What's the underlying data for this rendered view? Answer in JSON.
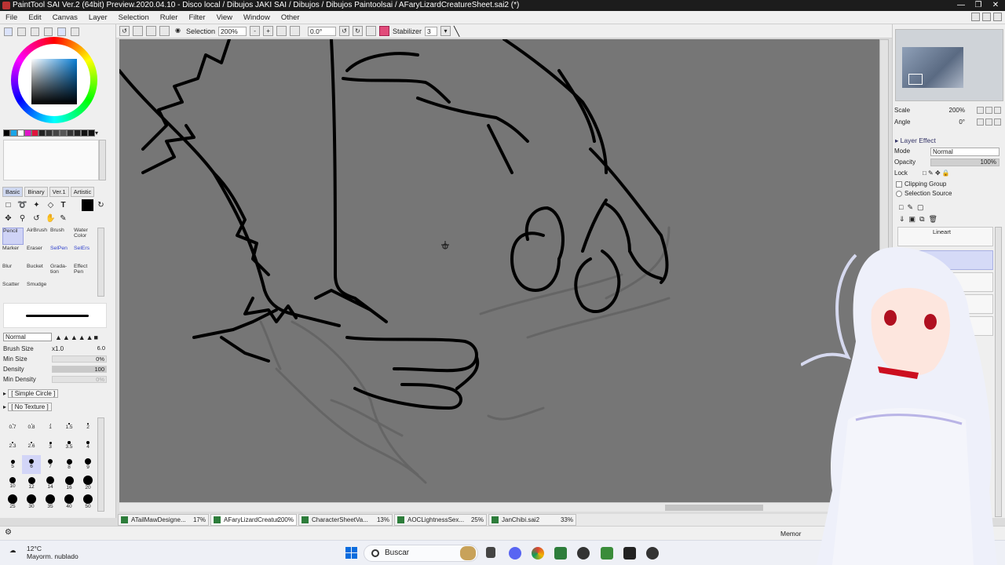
{
  "window": {
    "title": "PaintTool SAI Ver.2 (64bit) Preview.2020.04.10 - Disco local / Dibujos JAKI SAI / Dibujos / Dibujos Paintoolsai / AFaryLizardCreatureSheet.sai2 (*)"
  },
  "menu": [
    "File",
    "Edit",
    "Canvas",
    "Layer",
    "Selection",
    "Ruler",
    "Filter",
    "View",
    "Window",
    "Other"
  ],
  "toolbar": {
    "selection_label": "Selection",
    "zoom": "200%",
    "angle": "0.0°",
    "stabilizer_label": "Stabilizer",
    "stabilizer_value": "3"
  },
  "tool_tabs": [
    "Basic",
    "Binary",
    "Ver.1",
    "Artistic"
  ],
  "brushes": [
    {
      "name": "Pencil",
      "active": true
    },
    {
      "name": "AirBrush",
      "active": false
    },
    {
      "name": "Brush",
      "active": false
    },
    {
      "name": "Water Color",
      "active": false
    },
    {
      "name": "Marker",
      "active": false
    },
    {
      "name": "Eraser",
      "active": false
    },
    {
      "name": "SelPen",
      "active": false
    },
    {
      "name": "SelErs",
      "active": false
    },
    {
      "name": "Blur",
      "active": false
    },
    {
      "name": "Bucket",
      "active": false
    },
    {
      "name": "Grada- tion",
      "active": false
    },
    {
      "name": "Effect Pen",
      "active": false
    },
    {
      "name": "Scatter",
      "active": false
    },
    {
      "name": "Smudge",
      "active": false
    }
  ],
  "brush_settings": {
    "mode": "Normal",
    "brush_size_label": "Brush Size",
    "brush_size_mult": "x1.0",
    "brush_size": "6.0",
    "min_size_label": "Min Size",
    "min_size": "0%",
    "density_label": "Density",
    "density": "100",
    "min_density_label": "Min Density",
    "min_density": "0%",
    "shape": "[ Simple Circle ]",
    "texture": "[ No Texture ]"
  },
  "brush_sizes": [
    "0.7",
    "0.8",
    "1",
    "1.5",
    "2",
    "2.3",
    "2.6",
    "3",
    "3.5",
    "4",
    "5",
    "6",
    "7",
    "8",
    "9",
    "10",
    "12",
    "14",
    "16",
    "20",
    "25",
    "30",
    "35",
    "40",
    "50"
  ],
  "navigator": {
    "scale_label": "Scale",
    "scale": "200%",
    "angle_label": "Angle",
    "angle": "0°"
  },
  "layer_panel": {
    "effect_label": "Layer Effect",
    "mode_label": "Mode",
    "mode": "Normal",
    "opacity_label": "Opacity",
    "opacity": "100%",
    "lock_label": "Lock",
    "clipping": "Clipping Group",
    "selection_source": "Selection Source",
    "layers": [
      "Lineart",
      "",
      "",
      "",
      ""
    ]
  },
  "doc_tabs": [
    {
      "name": "ATailMawDesigne...",
      "zoom": "17%",
      "active": false
    },
    {
      "name": "AFaryLizardCreatur...",
      "zoom": "200%",
      "active": true
    },
    {
      "name": "CharacterSheetVa...",
      "zoom": "13%",
      "active": false
    },
    {
      "name": "AOCLightnessSex...",
      "zoom": "25%",
      "active": false
    },
    {
      "name": "JanChibi.sai2",
      "zoom": "33%",
      "active": false
    }
  ],
  "statusbar": {
    "memory": "Memor"
  },
  "taskbar": {
    "temp": "12°C",
    "weather": "Mayorm. nublado",
    "search": "Buscar"
  },
  "colors": {
    "canvas_bg": "#767676",
    "accent": "#0a6cde",
    "active_tab": "#cfd3f6"
  }
}
